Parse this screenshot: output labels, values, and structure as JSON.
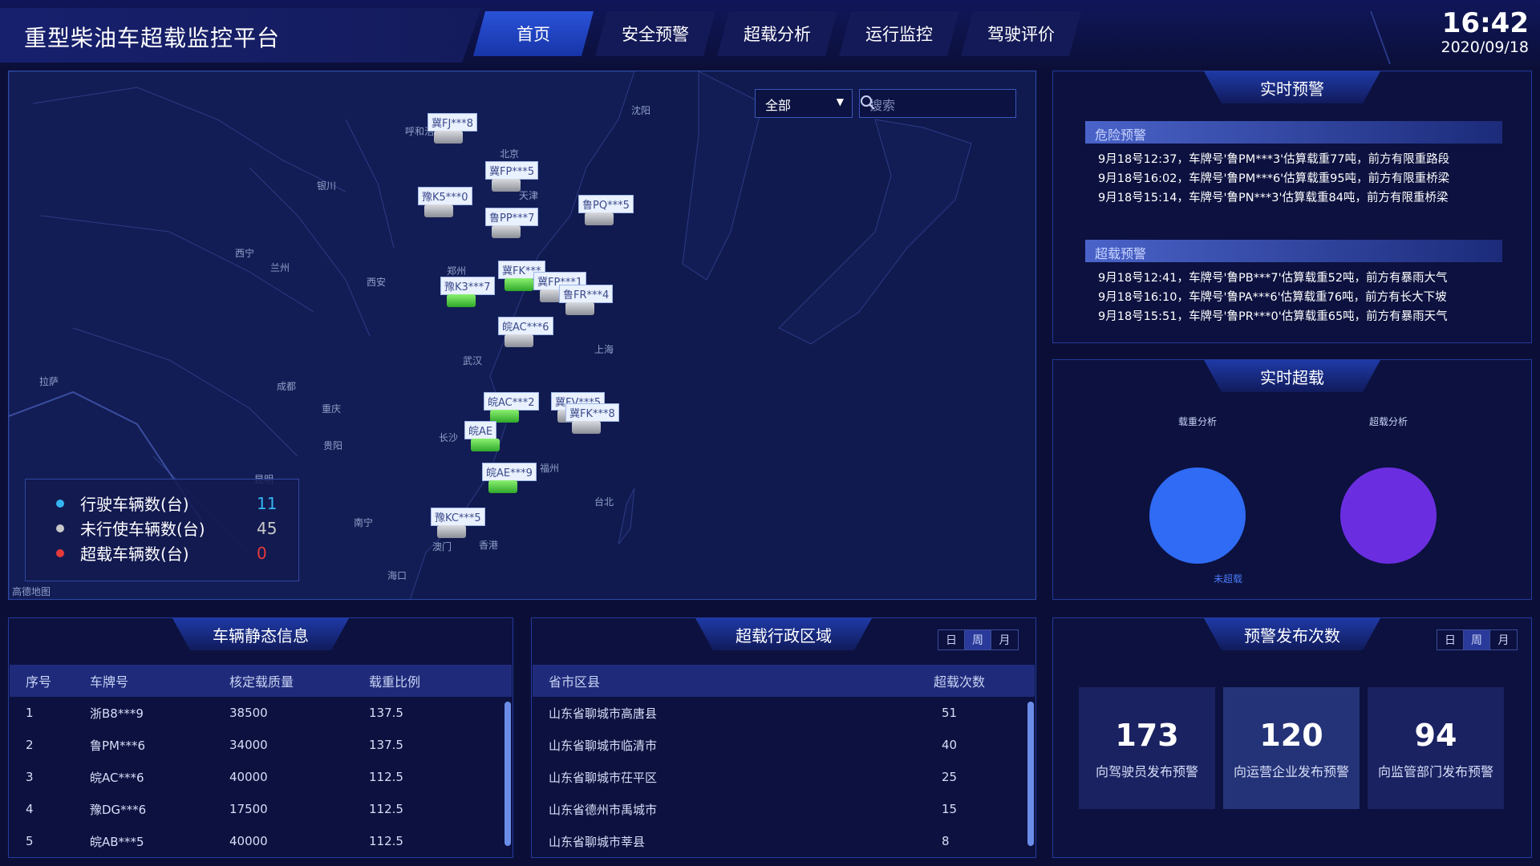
{
  "app": {
    "title": "重型柴油车超载监控平台"
  },
  "nav": {
    "tabs": [
      "首页",
      "安全预警",
      "超载分析",
      "运行监控",
      "驾驶评价"
    ],
    "active": 0
  },
  "clock": {
    "time": "16:42",
    "date": "2020/09/18"
  },
  "map": {
    "filter": "全部",
    "search_placeholder": "搜索",
    "cities": [
      "沈阳",
      "北京",
      "天津",
      "呼和浩特",
      "银川",
      "西宁",
      "兰州",
      "西安",
      "郑州",
      "武汉",
      "上海",
      "成都",
      "重庆",
      "拉萨",
      "长沙",
      "贵阳",
      "福州",
      "昆明",
      "南宁",
      "台北",
      "澳门",
      "香港",
      "海口"
    ],
    "vehicles": [
      "冀FJ***8",
      "冀FP***5",
      "豫K5***0",
      "鲁PP***7",
      "鲁PQ***5",
      "冀FK***",
      "冀FP***1",
      "豫K3***7",
      "鲁FR***4",
      "皖AC***6",
      "皖AC***2",
      "冀FV***5",
      "冀FK***8",
      "皖AE",
      "皖AE***9",
      "豫KC***5"
    ],
    "legend": [
      {
        "label": "行驶车辆数(台)",
        "value": "11",
        "color": "#33b5f0"
      },
      {
        "label": "未行使车辆数(台)",
        "value": "45",
        "color": "#c8c8c8"
      },
      {
        "label": "超载车辆数(台)",
        "value": "0",
        "color": "#e63a3a"
      }
    ],
    "logo": "高德地图"
  },
  "realtime_warning": {
    "title": "实时预警",
    "danger": {
      "label": "危险预警",
      "items": [
        "9月18号12:37，车牌号'鲁PM***3'估算载重77吨，前方有限重路段",
        "9月18号16:02，车牌号'鲁PM***6'估算载重95吨，前方有限重桥梁",
        "9月18号15:14，车牌号'鲁PN***3'估算载重84吨，前方有限重桥梁"
      ]
    },
    "overload": {
      "label": "超载预警",
      "items": [
        "9月18号12:41，车牌号'鲁PB***7'估算载重52吨，前方有暴雨大气",
        "9月18号16:10，车牌号'鲁PA***6'估算载重76吨，前方有长大下坡",
        "9月18号15:51，车牌号'鲁PR***0'估算载重65吨，前方有暴雨天气"
      ]
    }
  },
  "realtime_overload": {
    "title": "实时超载",
    "load_analysis": {
      "label": "载重分析",
      "color": "#2f6bf5",
      "legend": "未超载"
    },
    "overload_analysis": {
      "label": "超载分析",
      "color": "#6a2ee0"
    }
  },
  "vehicle_static": {
    "title": "车辆静态信息",
    "columns": [
      "序号",
      "车牌号",
      "核定载质量",
      "载重比例"
    ],
    "rows": [
      [
        "1",
        "浙B8***9",
        "38500",
        "137.5"
      ],
      [
        "2",
        "鲁PM***6",
        "34000",
        "137.5"
      ],
      [
        "3",
        "皖AC***6",
        "40000",
        "112.5"
      ],
      [
        "4",
        "豫DG***6",
        "17500",
        "112.5"
      ],
      [
        "5",
        "皖AB***5",
        "40000",
        "112.5"
      ]
    ]
  },
  "overload_region": {
    "title": "超载行政区域",
    "periods": [
      "日",
      "周",
      "月"
    ],
    "active_period": 1,
    "columns": [
      "省市区县",
      "超载次数"
    ],
    "rows": [
      [
        "山东省聊城市高唐县",
        "51"
      ],
      [
        "山东省聊城市临清市",
        "40"
      ],
      [
        "山东省聊城市茌平区",
        "25"
      ],
      [
        "山东省德州市禹城市",
        "15"
      ],
      [
        "山东省聊城市莘县",
        "8"
      ]
    ]
  },
  "warning_count": {
    "title": "预警发布次数",
    "periods": [
      "日",
      "周",
      "月"
    ],
    "active_period": 1,
    "stats": [
      {
        "value": "173",
        "label": "向驾驶员发布预警"
      },
      {
        "value": "120",
        "label": "向运营企业发布预警"
      },
      {
        "value": "94",
        "label": "向监管部门发布预警"
      }
    ]
  }
}
